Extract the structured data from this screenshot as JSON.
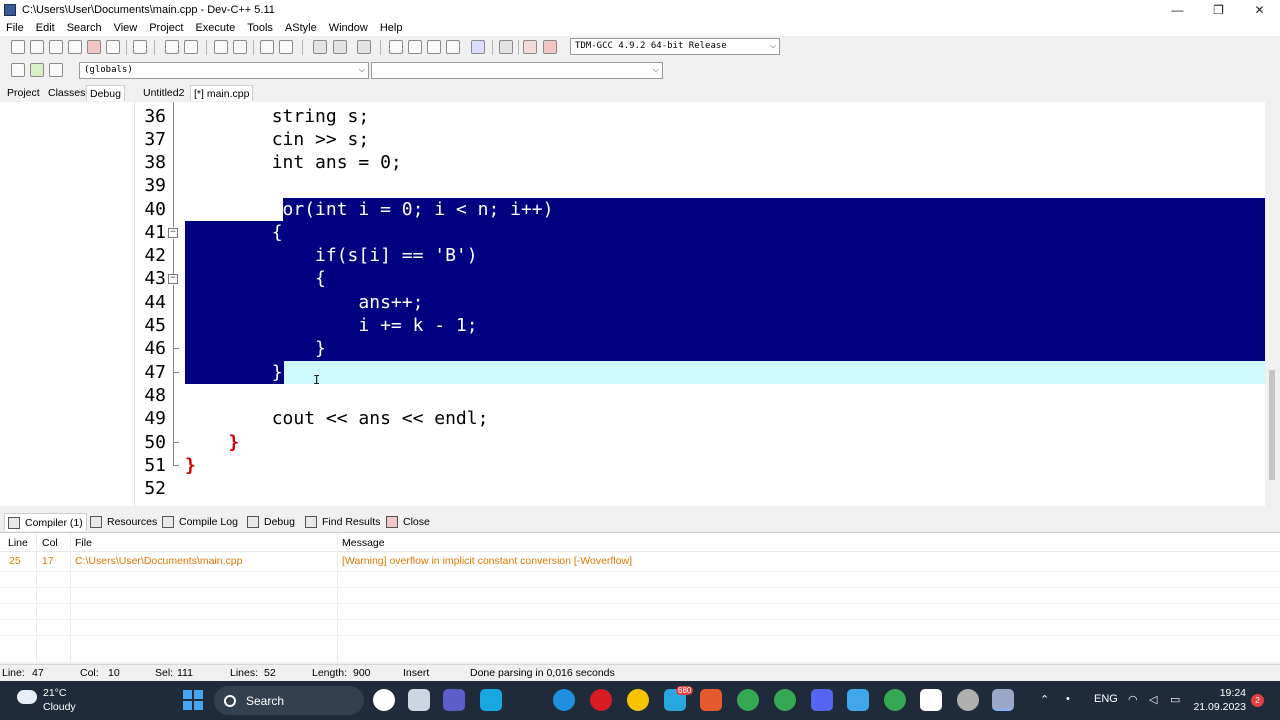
{
  "window": {
    "title": "C:\\Users\\User\\Documents\\main.cpp - Dev-C++ 5.11",
    "minimize_glyph": "—",
    "maximize_glyph": "❐",
    "close_glyph": "✕"
  },
  "menu": [
    "File",
    "Edit",
    "Search",
    "View",
    "Project",
    "Execute",
    "Tools",
    "AStyle",
    "Window",
    "Help"
  ],
  "toolbar": {
    "compiler_select": "TDM-GCC 4.9.2 64-bit Release",
    "globals_select": "(globals)",
    "function_select": ""
  },
  "panel_tabs": [
    "Project",
    "Classes",
    "Debug"
  ],
  "editor_tabs": [
    "Untitled2",
    "[*] main.cpp"
  ],
  "editor": {
    "lines": [
      {
        "n": "36",
        "code": "string s;"
      },
      {
        "n": "37",
        "code": "cin >> s;"
      },
      {
        "n": "38",
        "code": "int ans = 0;"
      },
      {
        "n": "39",
        "code": ""
      },
      {
        "n": "40",
        "code": "for(int i = 0; i < n; i++)"
      },
      {
        "n": "41",
        "code": "{"
      },
      {
        "n": "42",
        "code": "if(s[i] == 'B')"
      },
      {
        "n": "43",
        "code": "{"
      },
      {
        "n": "44",
        "code": "ans++;"
      },
      {
        "n": "45",
        "code": "i += k - 1;"
      },
      {
        "n": "46",
        "code": "}"
      },
      {
        "n": "47",
        "code": "}"
      },
      {
        "n": "48",
        "code": ""
      },
      {
        "n": "49",
        "code": "cout << ans << endl;"
      },
      {
        "n": "50",
        "code": "}"
      },
      {
        "n": "51",
        "code": "}"
      },
      {
        "n": "52",
        "code": ""
      }
    ],
    "selection_color": "#000080",
    "current_line_color": "#ccfaff",
    "operator_color": "#d10000",
    "number_color": "#9b009b"
  },
  "bottom_tabs": [
    "Compiler (1)",
    "Resources",
    "Compile Log",
    "Debug",
    "Find Results",
    "Close"
  ],
  "results": {
    "columns": [
      "Line",
      "Col",
      "File",
      "Message"
    ],
    "rows": [
      {
        "line": "25",
        "col": "17",
        "file": "C:\\Users\\User\\Documents\\main.cpp",
        "message": "[Warning] overflow in implicit constant conversion [-Woverflow]"
      }
    ],
    "warning_color": "#e07800"
  },
  "status": {
    "line_label": "Line:",
    "line_value": "47",
    "col_label": "Col:",
    "col_value": "10",
    "sel_label": "Sel:",
    "sel_value": "111",
    "lines_label": "Lines:",
    "lines_value": "52",
    "length_label": "Length:",
    "length_value": "900",
    "mode": "Insert",
    "message": "Done parsing in 0,016 seconds"
  },
  "taskbar": {
    "temperature": "21°C",
    "weather": "Cloudy",
    "search_label": "Search",
    "language": "ENG",
    "time": "19:24",
    "date": "21.09.2023",
    "notifications": "2",
    "badge_mail": "680"
  }
}
